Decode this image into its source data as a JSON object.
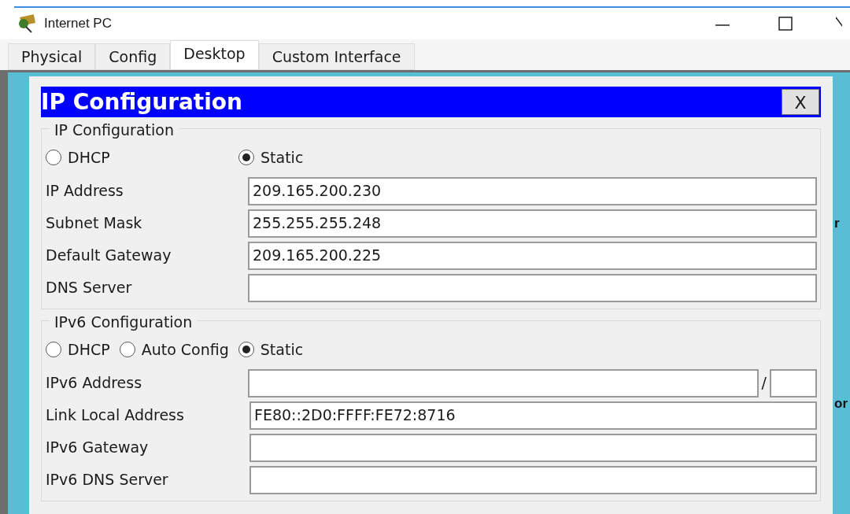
{
  "window": {
    "title": "Internet PC"
  },
  "tabs": [
    {
      "label": "Physical",
      "selected": false
    },
    {
      "label": "Config",
      "selected": false
    },
    {
      "label": "Desktop",
      "selected": true
    },
    {
      "label": "Custom Interface",
      "selected": false
    }
  ],
  "dialog": {
    "title": "IP Configuration",
    "close": "X",
    "ipv4": {
      "legend": "IP Configuration",
      "modes": [
        {
          "label": "DHCP",
          "selected": false
        },
        {
          "label": "Static",
          "selected": true
        }
      ],
      "fields": [
        {
          "label": "IP Address",
          "value": "209.165.200.230"
        },
        {
          "label": "Subnet Mask",
          "value": "255.255.255.248"
        },
        {
          "label": "Default Gateway",
          "value": "209.165.200.225"
        },
        {
          "label": "DNS Server"
        }
      ]
    },
    "ipv6": {
      "legend": "IPv6 Configuration",
      "modes": [
        {
          "label": "DHCP",
          "selected": false
        },
        {
          "label": "Auto Config",
          "selected": false
        },
        {
          "label": "Static",
          "selected": true
        }
      ],
      "fields": [
        {
          "label": "IPv6 Address",
          "kind": "prefix",
          "separator": "/"
        },
        {
          "label": "Link Local Address",
          "kind": "plain",
          "value": "FE80::2D0:FFFF:FE72:8716"
        },
        {
          "label": "IPv6 Gateway",
          "kind": "plain"
        },
        {
          "label": "IPv6 DNS Server",
          "kind": "plain"
        }
      ]
    }
  },
  "background_fragments": [
    "r",
    "or"
  ]
}
